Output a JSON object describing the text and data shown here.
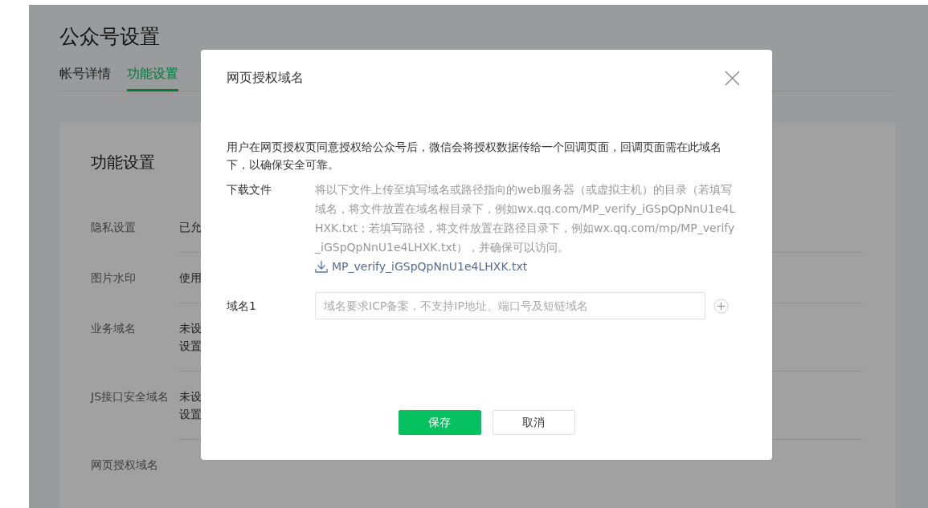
{
  "page": {
    "title": "公众号设置",
    "tabs": [
      {
        "label": "帐号详情",
        "selected": false
      },
      {
        "label": "功能设置",
        "selected": true
      }
    ],
    "card": {
      "title": "功能设置",
      "rows": [
        {
          "label": "隐私设置",
          "value": [
            "已允"
          ]
        },
        {
          "label": "图片水印",
          "value": [
            "使用"
          ]
        },
        {
          "label": "业务域名",
          "value": [
            "未设",
            "设置"
          ]
        },
        {
          "label": "JS接口安全域名",
          "value": [
            "未设",
            "设置"
          ]
        },
        {
          "label": "网页授权域名",
          "value": []
        }
      ]
    }
  },
  "dialog": {
    "title": "网页授权域名",
    "description": "用户在网页授权页同意授权给公众号后，微信会将授权数据传给一个回调页面，回调页面需在此域名下，以确保安全可靠。",
    "download": {
      "label": "下载文件",
      "instructions": "将以下文件上传至填写域名或路径指向的web服务器（或虚拟主机）的目录（若填写域名，将文件放置在域名根目录下，例如wx.qq.com/MP_verify_iGSpQpNnU1e4LHXK.txt；若填写路径，将文件放置在路径目录下，例如wx.qq.com/mp/MP_verify_iGSpQpNnU1e4LHXK.txt），并确保可以访问。",
      "file_link": "MP_verify_iGSpQpNnU1e4LHXK.txt"
    },
    "domains": [
      {
        "label": "域名1",
        "placeholder": "域名要求ICP备案，不支持IP地址、端口号及短链域名"
      }
    ],
    "buttons": [
      {
        "label": "保存",
        "kind": "primary"
      },
      {
        "label": "取消",
        "kind": "default"
      }
    ]
  }
}
